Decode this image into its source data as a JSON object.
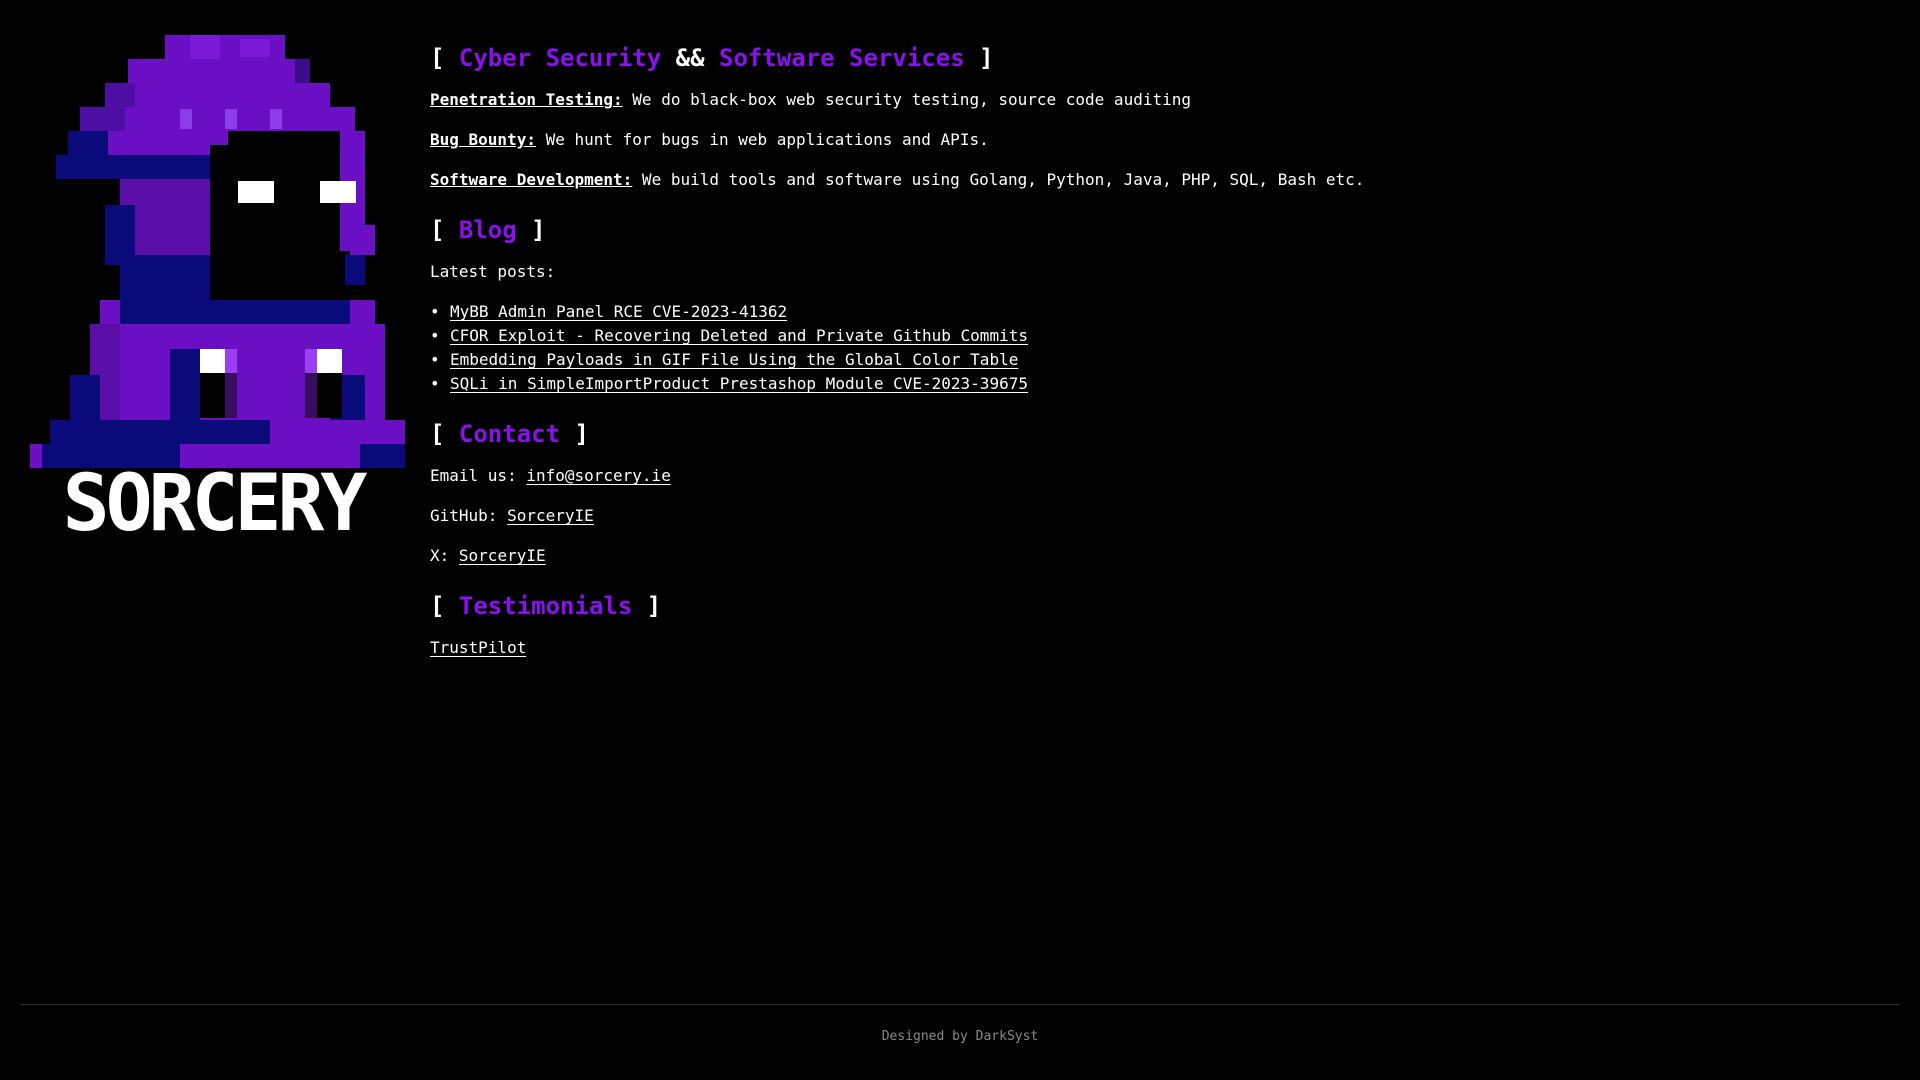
{
  "brand": {
    "wordmark": "SORCERY",
    "colors": {
      "accent": "#8b10ee",
      "background": "#000000",
      "text": "#ffffff",
      "footer_text": "#8a8a8a",
      "logo_purple_dark": "#5b0fa8",
      "logo_navy": "#0a0a7a"
    }
  },
  "services": {
    "heading_open": "[ ",
    "heading_part1": "Cyber Security",
    "heading_join": " && ",
    "heading_part2": "Software Services",
    "heading_close": " ]",
    "items": [
      {
        "label": "Penetration Testing:",
        "text": " We do black-box web security testing, source code auditing"
      },
      {
        "label": "Bug Bounty:",
        "text": " We hunt for bugs in web applications and APIs."
      },
      {
        "label": "Software Development:",
        "text": " We build tools and software using Golang, Python, Java, PHP, SQL, Bash etc."
      }
    ]
  },
  "blog": {
    "heading_open": "[ ",
    "heading": "Blog",
    "heading_close": " ]",
    "intro": "Latest posts:",
    "bullet": "•",
    "posts": [
      "MyBB Admin Panel RCE CVE-2023-41362",
      "CFOR Exploit - Recovering Deleted and Private Github Commits",
      "Embedding Payloads in GIF File Using the Global Color Table",
      "SQLi in SimpleImportProduct Prestashop Module CVE-2023-39675"
    ]
  },
  "contact": {
    "heading_open": "[ ",
    "heading": "Contact",
    "heading_close": " ]",
    "email_label": "Email us: ",
    "email": "info@sorcery.ie",
    "github_label": "GitHub: ",
    "github": "SorceryIE",
    "x_label": "X: ",
    "x": "SorceryIE"
  },
  "testimonials": {
    "heading_open": "[ ",
    "heading": "Testimonials",
    "heading_close": " ]",
    "link": "TrustPilot"
  },
  "footer": {
    "text": "Designed by DarkSyst"
  }
}
